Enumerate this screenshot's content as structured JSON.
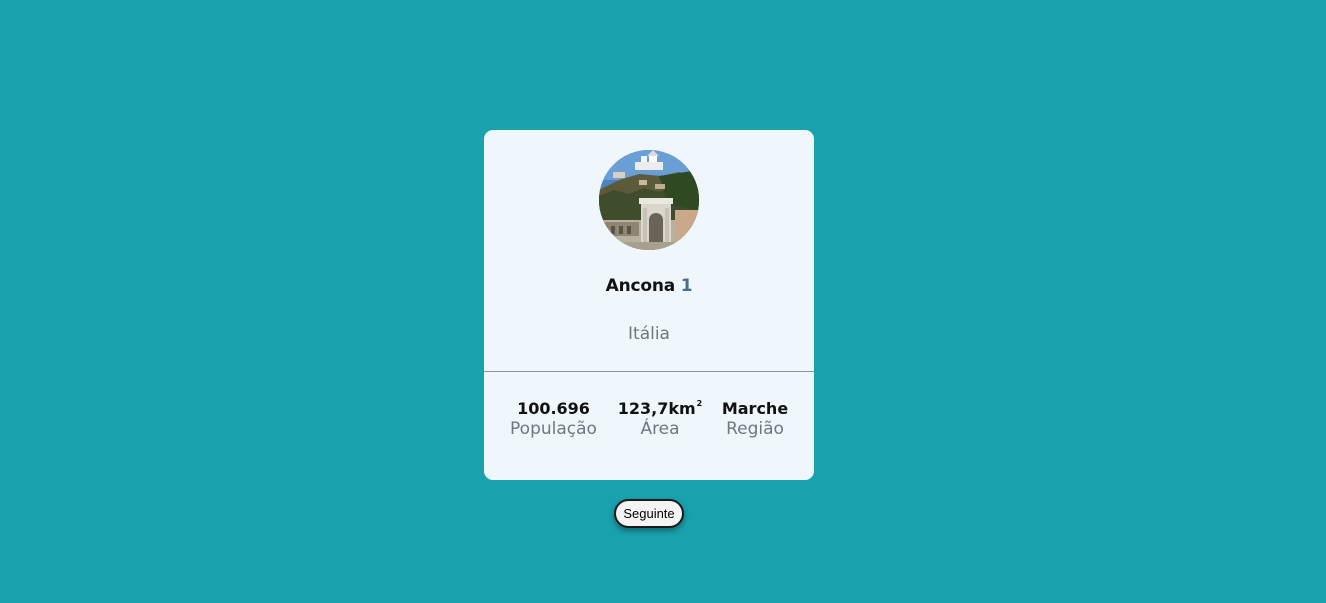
{
  "city": {
    "name": "Ancona",
    "rank": "1",
    "country": "Itália",
    "photo_icon": "city-photo-arch"
  },
  "stats": {
    "population": {
      "value": "100.696",
      "label": "População"
    },
    "area": {
      "value": "123,7km",
      "unit_sup": "2",
      "label": "Área"
    },
    "region": {
      "value": "Marche",
      "label": "Região"
    }
  },
  "actions": {
    "next_label": "Seguinte"
  },
  "colors": {
    "background": "#1aa1ae",
    "card": "#eff7fd",
    "rank": "#4f6b86",
    "muted_text": "#6f7680"
  }
}
